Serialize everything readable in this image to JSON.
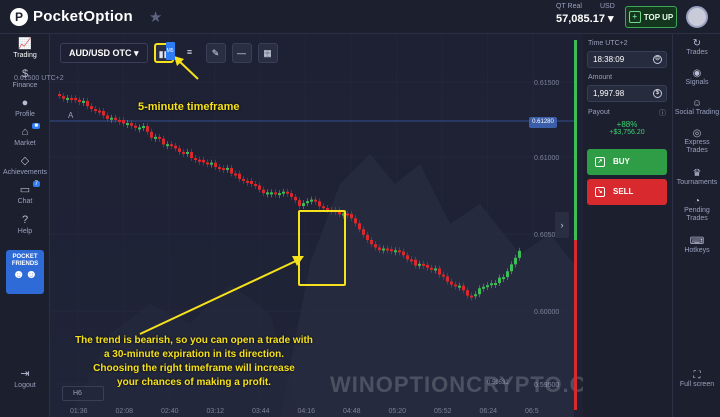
{
  "header": {
    "logo_text": "PocketOption",
    "account_type": "QT Real",
    "currency": "USD",
    "balance": "57,085.17",
    "topup_label": "TOP UP"
  },
  "sidebar": {
    "items": [
      {
        "label": "Trading",
        "icon": "chart-icon"
      },
      {
        "label": "Finance",
        "icon": "dollar-icon"
      },
      {
        "label": "Profile",
        "icon": "user-icon"
      },
      {
        "label": "Market",
        "icon": "cart-icon",
        "badge": ""
      },
      {
        "label": "Achievements",
        "icon": "diamond-icon"
      },
      {
        "label": "Chat",
        "icon": "chat-icon",
        "badge": "7"
      },
      {
        "label": "Help",
        "icon": "help-icon"
      }
    ],
    "friends_line1": "POCKET",
    "friends_line2": "FRIENDS",
    "logout_label": "Logout"
  },
  "toolbar": {
    "pair": "AUD/USD OTC",
    "timeframe_badge": "M5"
  },
  "chart": {
    "corner_price": "0.61500",
    "corner_tz": "UTC+2",
    "indicator_a": "A",
    "timeframe_selector": "H6",
    "current_price_tag": "0.61280",
    "y_labels": [
      "0.61500",
      "0.61000",
      "0.60500",
      "0.60000",
      "0.59500"
    ],
    "x_labels": [
      "01:36",
      "02:08",
      "02:40",
      "03:12",
      "03:44",
      "04:16",
      "04:48",
      "05:20",
      "05:52",
      "06:24",
      "06:5"
    ],
    "bottom_value": "0.59532"
  },
  "annotations": {
    "timeframe_note": "5-minute timeframe",
    "line1": "The trend is bearish, so you can open a trade with",
    "line2": "a 30-minute expiration in its direction.",
    "line3": "Choosing the right timeframe will increase",
    "line4": "your chances of making a profit.",
    "watermark": "WINOPTIONCRYPTO.COM"
  },
  "panel": {
    "time_label": "Time UTC+2",
    "time_value": "18:38:09",
    "amount_label": "Amount",
    "amount_value": "1,997.98",
    "payout_label": "Payout",
    "payout_pct": "+88%",
    "payout_amt": "+$3,756.20",
    "buy_label": "BUY",
    "sell_label": "SELL"
  },
  "rightbar": {
    "items": [
      "Trades",
      "Signals",
      "Social Trading",
      "Express Trades",
      "Tournaments",
      "Pending Trades",
      "Hotkeys"
    ],
    "fullscreen_label": "Full screen"
  },
  "colors": {
    "up": "#3dbd57",
    "down": "#d8292f",
    "accent": "#f5e11c"
  }
}
